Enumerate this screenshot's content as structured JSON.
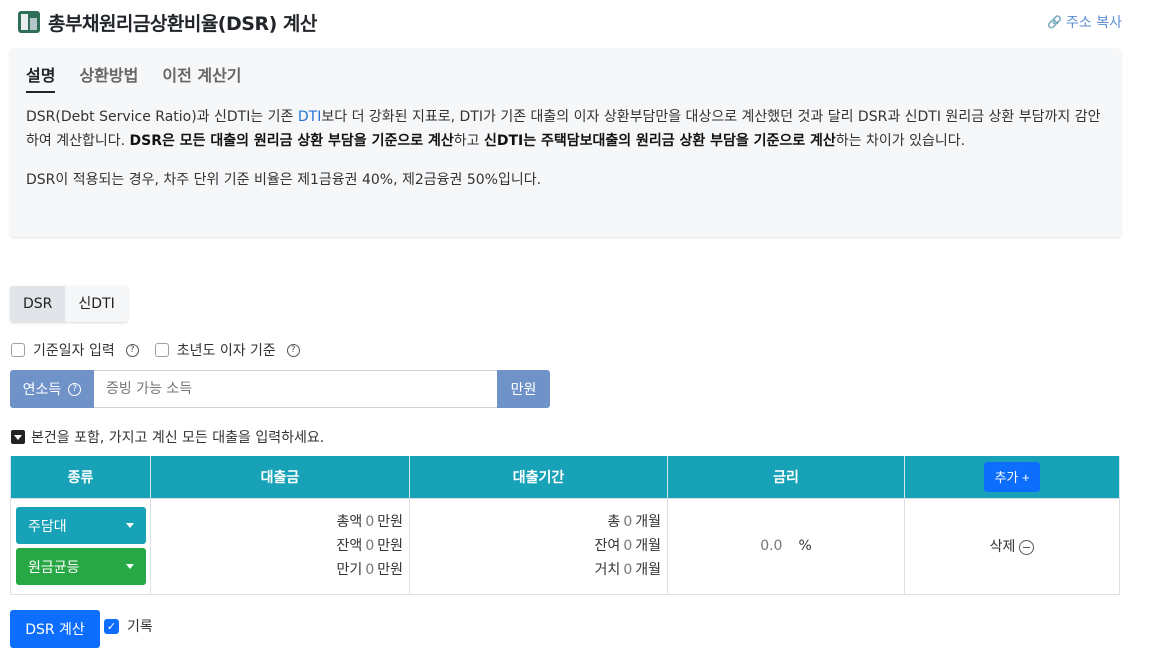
{
  "header": {
    "title": "총부채원리금상환비율(DSR) 계산",
    "copy_link": "주소 복사"
  },
  "info": {
    "tabs": [
      "설명",
      "상환방법",
      "이전 계산기"
    ],
    "para1": {
      "p1": "DSR(Debt Service Ratio)과 신DTI는 기존 ",
      "link": "DTI",
      "p2": "보다 더 강화된 지표로, DTI가 기존 대출의 이자 상환부담만을 대상으로 계산했던 것과 달리 DSR과 신DTI 원리금 상환 부담까지 감안하여 계산합니다. ",
      "bold1": "DSR은 모든 대출의 원리금 상환 부담을 기준으로 계산",
      "p3": "하고 ",
      "bold2": "신DTI는 주택담보대출의 원리금 상환 부담을 기준으로 계산",
      "p4": "하는 차이가 있습니다."
    },
    "para2": "DSR이 적용되는 경우, 차주 단위 기준 비율은 제1금융권 40%, 제2금융권 50%입니다."
  },
  "mode": {
    "options": [
      "DSR",
      "신DTI"
    ],
    "selected": "DSR"
  },
  "options": {
    "base_date": "기준일자 입력",
    "first_year": "초년도 이자 기준"
  },
  "income": {
    "label": "연소득",
    "placeholder": "증빙 가능 소득",
    "unit": "만원"
  },
  "loan_note": "본건을 포함, 가지고 계신 모든 대출을 입력하세요.",
  "table": {
    "headers": [
      "종류",
      "대출금",
      "대출기간",
      "금리"
    ],
    "add_label": "추가 +",
    "row": {
      "type1": "주담대",
      "type2": "원금균등",
      "amount": [
        {
          "label": "총액",
          "value": "0",
          "unit": "만원"
        },
        {
          "label": "잔액",
          "value": "0",
          "unit": "만원"
        },
        {
          "label": "만기",
          "value": "0",
          "unit": "만원"
        }
      ],
      "period": [
        {
          "label": "총",
          "value": "0",
          "unit": "개월"
        },
        {
          "label": "잔여",
          "value": "0",
          "unit": "개월"
        },
        {
          "label": "거치",
          "value": "0",
          "unit": "개월"
        }
      ],
      "rate_value": "0.0",
      "rate_unit": "%",
      "delete_label": "삭제"
    }
  },
  "actions": {
    "calc_label": "DSR 계산",
    "record_label": "기록"
  }
}
